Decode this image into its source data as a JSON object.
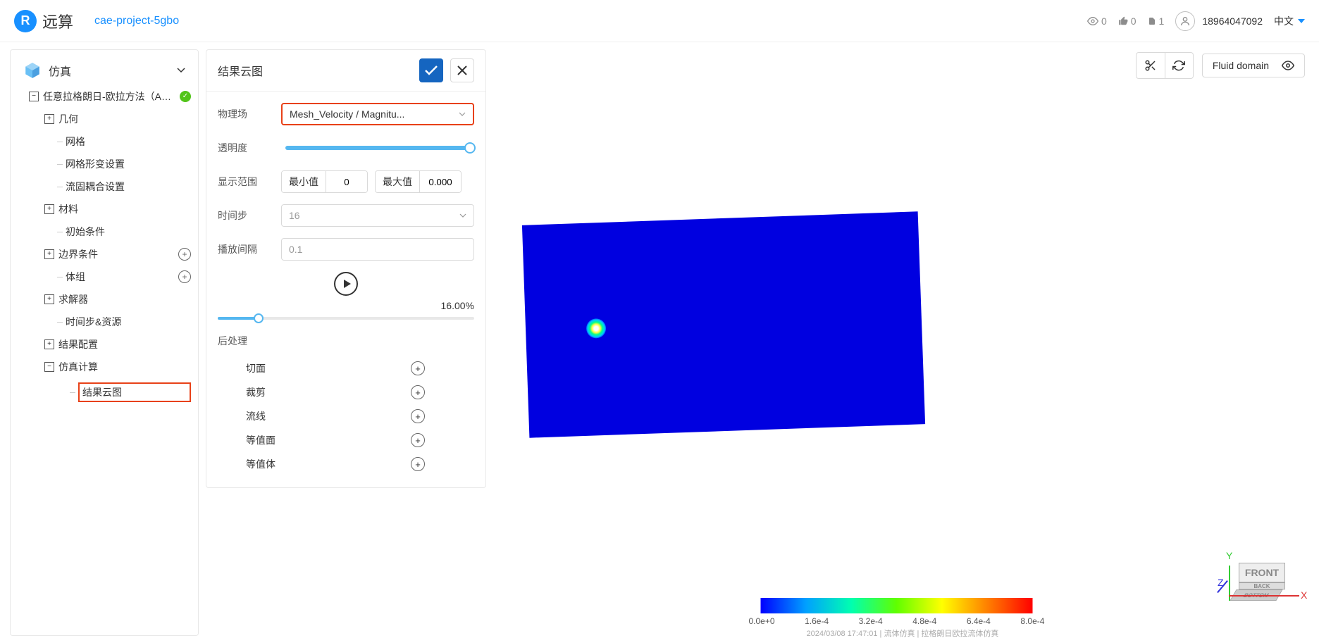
{
  "header": {
    "logo_text": "远算",
    "project_name": "cae-project-5gbo",
    "stats": {
      "views": "0",
      "likes": "0",
      "files": "1"
    },
    "user_phone": "18964047092",
    "lang": "中文"
  },
  "sidebar": {
    "title": "仿真",
    "root": {
      "label": "任意拉格朗日-欧拉方法（ALE..."
    },
    "items": [
      {
        "label": "几何",
        "toggle": "+",
        "indent": 42
      },
      {
        "label": "网格",
        "indent": 60,
        "leaf": true
      },
      {
        "label": "网格形变设置",
        "indent": 60,
        "leaf": true
      },
      {
        "label": "流固耦合设置",
        "indent": 60,
        "leaf": true
      },
      {
        "label": "材料",
        "toggle": "+",
        "indent": 42
      },
      {
        "label": "初始条件",
        "indent": 60,
        "leaf": true
      },
      {
        "label": "边界条件",
        "toggle": "+",
        "indent": 42,
        "add": true
      },
      {
        "label": "体组",
        "indent": 60,
        "leaf": true,
        "add": true
      },
      {
        "label": "求解器",
        "toggle": "+",
        "indent": 42
      },
      {
        "label": "时间步&资源",
        "indent": 60,
        "leaf": true
      },
      {
        "label": "结果配置",
        "toggle": "+",
        "indent": 42
      },
      {
        "label": "仿真计算",
        "toggle": "−",
        "indent": 42
      },
      {
        "label": "结果云图",
        "indent": 78,
        "leaf": true,
        "highlight": true
      }
    ]
  },
  "panel": {
    "title": "结果云图",
    "physics_field": {
      "label": "物理场",
      "value": "Mesh_Velocity / Magnitu..."
    },
    "transparency": {
      "label": "透明度",
      "value": 100
    },
    "range": {
      "label": "显示范围",
      "min_label": "最小值",
      "min_value": "0",
      "max_label": "最大值",
      "max_value": "0.000"
    },
    "timestep": {
      "label": "时间步",
      "value": "16"
    },
    "interval": {
      "label": "播放间隔",
      "value": "0.1"
    },
    "progress": "16.00%",
    "post_section": "后处理",
    "post_items": [
      "切面",
      "裁剪",
      "流线",
      "等值面",
      "等值体"
    ]
  },
  "viewport": {
    "domain_label": "Fluid domain",
    "colorbar_ticks": [
      "0.0e+0",
      "1.6e-4",
      "3.2e-4",
      "4.8e-4",
      "6.4e-4",
      "8.0e-4"
    ],
    "footer": "2024/03/08  17:47:01  |  流体仿真  |  拉格朗日欧拉流体仿真",
    "axes": {
      "x": "X",
      "y": "Y",
      "z": "Z",
      "front": "FRONT",
      "back": "BACK",
      "bottom": "BOTTOM"
    }
  }
}
